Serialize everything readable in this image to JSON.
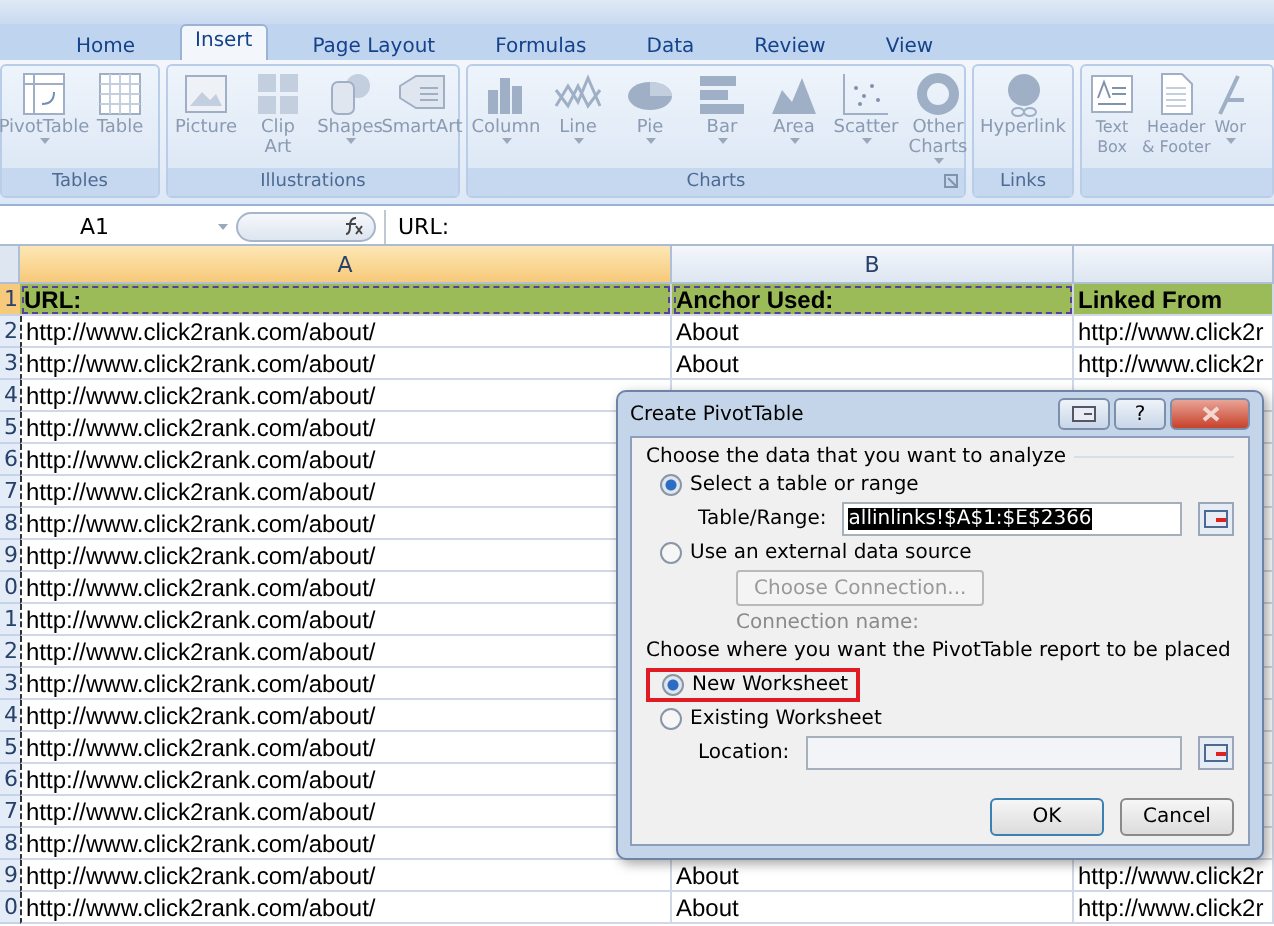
{
  "ribbon": {
    "tabs": [
      {
        "label": "Home",
        "selected": false
      },
      {
        "label": "Insert",
        "selected": true
      },
      {
        "label": "Page Layout",
        "selected": false
      },
      {
        "label": "Formulas",
        "selected": false
      },
      {
        "label": "Data",
        "selected": false
      },
      {
        "label": "Review",
        "selected": false
      },
      {
        "label": "View",
        "selected": false
      }
    ],
    "groups": [
      {
        "label": "Tables",
        "buttons": [
          {
            "kind": "pivottable",
            "lines": [
              "PivotTable"
            ],
            "menu": true
          },
          {
            "kind": "table",
            "lines": [
              "Table"
            ]
          }
        ]
      },
      {
        "label": "Illustrations",
        "buttons": [
          {
            "kind": "picture",
            "lines": [
              "Picture"
            ]
          },
          {
            "kind": "clipart",
            "lines": [
              "Clip",
              "Art"
            ]
          },
          {
            "kind": "shapes",
            "lines": [
              "Shapes"
            ],
            "menu": true
          },
          {
            "kind": "smartart",
            "lines": [
              "SmartArt"
            ]
          }
        ]
      },
      {
        "label": "Charts",
        "launcher": true,
        "buttons": [
          {
            "kind": "column",
            "lines": [
              "Column"
            ],
            "menu": true
          },
          {
            "kind": "line",
            "lines": [
              "Line"
            ],
            "menu": true
          },
          {
            "kind": "pie",
            "lines": [
              "Pie"
            ],
            "menu": true
          },
          {
            "kind": "bar",
            "lines": [
              "Bar"
            ],
            "menu": true
          },
          {
            "kind": "area",
            "lines": [
              "Area"
            ],
            "menu": true
          },
          {
            "kind": "scatter",
            "lines": [
              "Scatter"
            ],
            "menu": true
          },
          {
            "kind": "other",
            "lines": [
              "Other",
              "Charts"
            ],
            "menu": true
          }
        ]
      },
      {
        "label": "Links",
        "buttons": [
          {
            "kind": "hyperlink",
            "lines": [
              "Hyperlink"
            ]
          }
        ]
      },
      {
        "buttons": [
          {
            "kind": "textbox",
            "lines": [
              "Text",
              "Box"
            ]
          },
          {
            "kind": "header",
            "lines": [
              "Header",
              "& Footer"
            ]
          },
          {
            "kind": "wordart",
            "lines": [
              "Wor"
            ],
            "menu": true
          }
        ]
      }
    ]
  },
  "formula_bar": {
    "name_box": "A1",
    "value": "URL:"
  },
  "sheet": {
    "columns": [
      {
        "label": "A",
        "selected": true
      },
      {
        "label": "B",
        "selected": false
      }
    ],
    "rows": [
      {
        "number": "1",
        "selected": true,
        "header": true,
        "cells": [
          "URL:",
          "Anchor Used:",
          "Linked From"
        ]
      },
      {
        "number": "2",
        "selected": false,
        "header": false,
        "cells": [
          "http://www.click2rank.com/about/",
          "About",
          "http://www.click2r"
        ]
      },
      {
        "number": "3",
        "selected": false,
        "header": false,
        "cells": [
          "http://www.click2rank.com/about/",
          "About",
          "http://www.click2r"
        ]
      },
      {
        "number": "4",
        "selected": false,
        "header": false,
        "cells": [
          "http://www.click2rank.com/about/"
        ]
      },
      {
        "number": "5",
        "selected": false,
        "header": false,
        "cells": [
          "http://www.click2rank.com/about/"
        ]
      },
      {
        "number": "6",
        "selected": false,
        "header": false,
        "cells": [
          "http://www.click2rank.com/about/"
        ]
      },
      {
        "number": "7",
        "selected": false,
        "header": false,
        "cells": [
          "http://www.click2rank.com/about/"
        ]
      },
      {
        "number": "8",
        "selected": false,
        "header": false,
        "cells": [
          "http://www.click2rank.com/about/"
        ]
      },
      {
        "number": "9",
        "selected": false,
        "header": false,
        "cells": [
          "http://www.click2rank.com/about/"
        ]
      },
      {
        "number": "0",
        "selected": false,
        "header": false,
        "cells": [
          "http://www.click2rank.com/about/"
        ]
      },
      {
        "number": "1",
        "selected": false,
        "header": false,
        "cells": [
          "http://www.click2rank.com/about/"
        ]
      },
      {
        "number": "2",
        "selected": false,
        "header": false,
        "cells": [
          "http://www.click2rank.com/about/"
        ]
      },
      {
        "number": "3",
        "selected": false,
        "header": false,
        "cells": [
          "http://www.click2rank.com/about/"
        ]
      },
      {
        "number": "4",
        "selected": false,
        "header": false,
        "cells": [
          "http://www.click2rank.com/about/"
        ]
      },
      {
        "number": "5",
        "selected": false,
        "header": false,
        "cells": [
          "http://www.click2rank.com/about/"
        ]
      },
      {
        "number": "6",
        "selected": false,
        "header": false,
        "cells": [
          "http://www.click2rank.com/about/"
        ]
      },
      {
        "number": "7",
        "selected": false,
        "header": false,
        "cells": [
          "http://www.click2rank.com/about/"
        ]
      },
      {
        "number": "8",
        "selected": false,
        "header": false,
        "cells": [
          "http://www.click2rank.com/about/"
        ]
      },
      {
        "number": "9",
        "selected": false,
        "header": false,
        "cells": [
          "http://www.click2rank.com/about/",
          "About",
          "http://www.click2r"
        ]
      },
      {
        "number": "0",
        "selected": false,
        "header": false,
        "cells": [
          "http://www.click2rank.com/about/",
          "About",
          "http://www.click2r"
        ]
      }
    ]
  },
  "dialog": {
    "title": "Create PivotTable",
    "help": "?",
    "section_1": "Choose the data that you want to analyze",
    "source_options": [
      {
        "label": "Select a table or range",
        "selected": true
      },
      {
        "label": "Use an external data source",
        "selected": false
      }
    ],
    "range_label": "Table/Range:",
    "range_value": "allinlinks!$A$1:$E$2366",
    "connection_button": "Choose Connection...",
    "connection_label": "Connection name:",
    "section_2": "Choose where you want the PivotTable report to be placed",
    "target_options": [
      {
        "label": "New Worksheet",
        "selected": true
      },
      {
        "label": "Existing Worksheet",
        "selected": false
      }
    ],
    "location_label": "Location:",
    "buttons": [
      "OK",
      "Cancel"
    ]
  }
}
